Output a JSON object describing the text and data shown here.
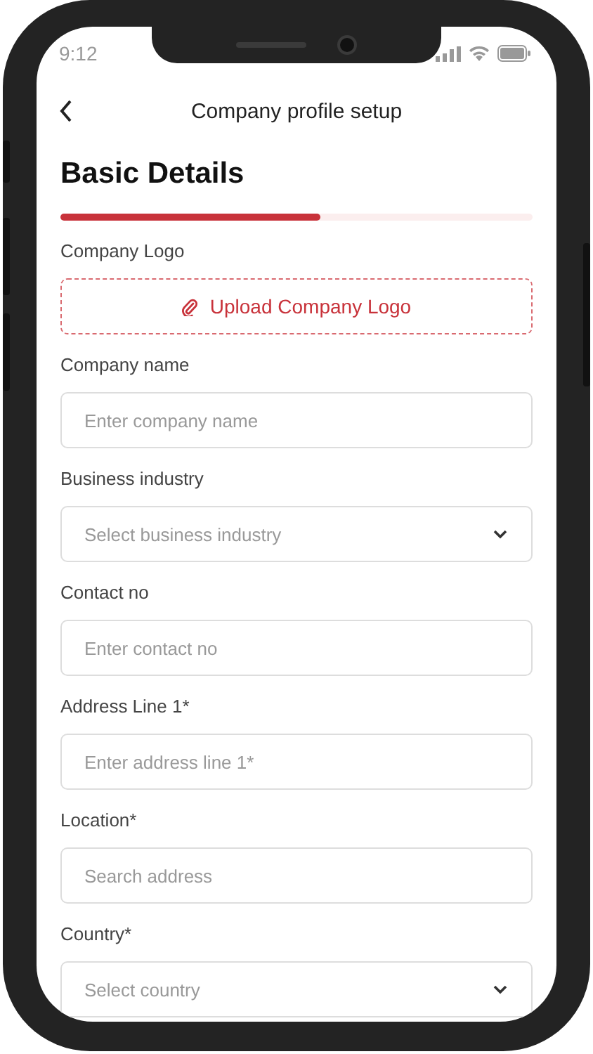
{
  "status_bar": {
    "time": "9:12"
  },
  "header": {
    "title": "Company profile setup"
  },
  "section_title": "Basic Details",
  "progress": {
    "level": 0.55
  },
  "fields": [
    {
      "label": "Company Logo",
      "kind": "upload",
      "text": "Upload Company Logo"
    },
    {
      "label": "Company name",
      "kind": "text",
      "placeholder": "Enter company name"
    },
    {
      "label": "Business industry",
      "kind": "select",
      "placeholder": "Select business industry"
    },
    {
      "label": "Contact no",
      "kind": "text",
      "placeholder": "Enter contact no"
    },
    {
      "label": "Address Line 1*",
      "kind": "text",
      "placeholder": "Enter address line 1*"
    },
    {
      "label": "Location*",
      "kind": "text",
      "placeholder": "Search address"
    },
    {
      "label": "Country*",
      "kind": "select",
      "placeholder": "Select country"
    }
  ]
}
